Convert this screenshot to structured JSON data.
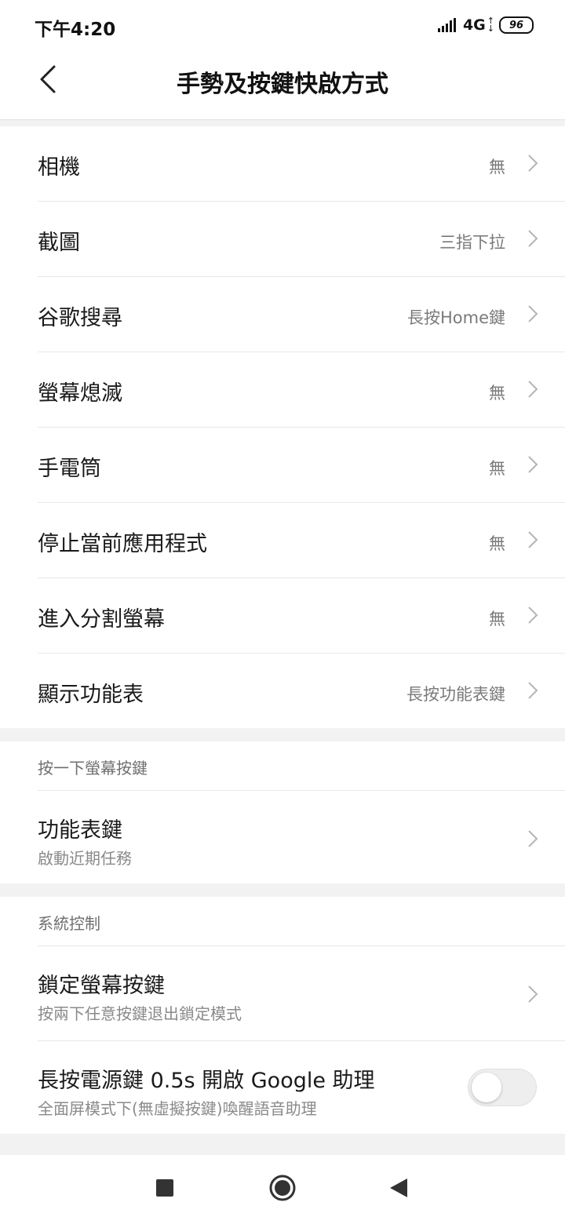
{
  "status_bar": {
    "time": "下午4:20",
    "network": "4G",
    "battery": "96"
  },
  "header": {
    "title": "手勢及按鍵快啟方式",
    "back_icon": "chevron-left-icon"
  },
  "shortcuts": [
    {
      "label": "相機",
      "value": "無"
    },
    {
      "label": "截圖",
      "value": "三指下拉"
    },
    {
      "label": "谷歌搜尋",
      "value": "長按Home鍵"
    },
    {
      "label": "螢幕熄滅",
      "value": "無"
    },
    {
      "label": "手電筒",
      "value": "無"
    },
    {
      "label": "停止當前應用程式",
      "value": "無"
    },
    {
      "label": "進入分割螢幕",
      "value": "無"
    },
    {
      "label": "顯示功能表",
      "value": "長按功能表鍵"
    }
  ],
  "press_screen_key": {
    "header": "按一下螢幕按鍵",
    "items": [
      {
        "label": "功能表鍵",
        "sub": "啟動近期任務"
      }
    ]
  },
  "system_control": {
    "header": "系統控制",
    "lock_key": {
      "label": "鎖定螢幕按鍵",
      "sub": "按兩下任意按鍵退出鎖定模式"
    },
    "google_assistant": {
      "label": "長按電源鍵 0.5s 開啟 Google 助理",
      "sub": "全面屏模式下(無虛擬按鍵)喚醒語音助理",
      "enabled": false
    }
  },
  "nav": {
    "recents_icon": "square-icon",
    "home_icon": "circle-icon",
    "back_icon": "triangle-back-icon"
  }
}
